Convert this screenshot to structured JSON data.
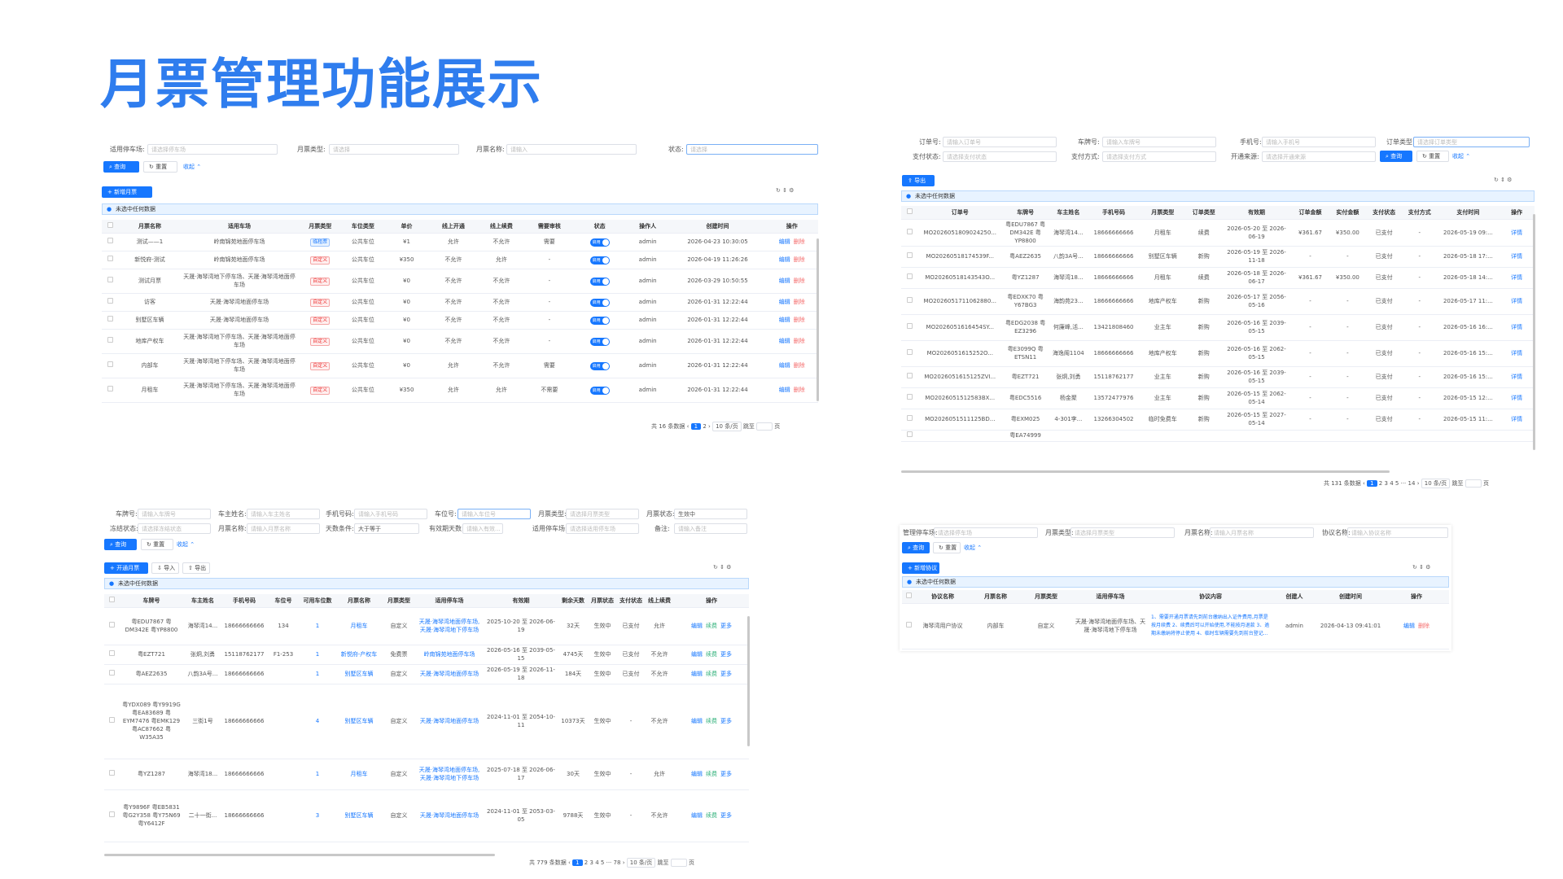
{
  "page_title": "月票管理功能展示",
  "p1": {
    "lbl_park": "适用停车场:",
    "ph_park": "请选择停车场",
    "lbl_type": "月票类型:",
    "ph_type": "请选择",
    "lbl_name": "月票名称:",
    "ph_name": "请输入",
    "lbl_status": "状态:",
    "ph_status": "请选择",
    "query": "查询",
    "reset": "重置",
    "collapse": "收起",
    "add": "新增月票",
    "info": "未选中任何数据",
    "headers": [
      "月票名称",
      "适用车场",
      "月票类型",
      "车位类型",
      "单价",
      "线上开通",
      "线上续费",
      "需要审核",
      "状态",
      "操作人",
      "创建时间",
      "操作"
    ],
    "rows": [
      [
        "测试——1",
        "岭南锦苑地面停车场",
        "临租票",
        "公共车位",
        "¥1",
        "允许",
        "不允许",
        "需要",
        "admin",
        "2026-04-23 10:30:05"
      ],
      [
        "新悦府-测试",
        "岭南锦苑地面停车场",
        "自定义",
        "公共车位",
        "¥350",
        "不允许",
        "允许",
        "-",
        "admin",
        "2026-04-19 11:26:26"
      ],
      [
        "测试月票",
        "天晟·海琴湾地下停车场、天晟·海琴湾地面停车场",
        "自定义",
        "公共车位",
        "¥0",
        "不允许",
        "不允许",
        "-",
        "admin",
        "2026-03-29 10:50:55"
      ],
      [
        "访客",
        "天晟·海琴湾地面停车场",
        "自定义",
        "公共车位",
        "¥0",
        "不允许",
        "不允许",
        "-",
        "admin",
        "2026-01-31 12:22:44"
      ],
      [
        "别墅区车辆",
        "天晟·海琴湾地面停车场",
        "自定义",
        "公共车位",
        "¥0",
        "不允许",
        "不允许",
        "-",
        "admin",
        "2026-01-31 12:22:44"
      ],
      [
        "地库产权车",
        "天晟·海琴湾地下停车场、天晟·海琴湾地面停车场",
        "自定义",
        "公共车位",
        "¥0",
        "不允许",
        "不允许",
        "-",
        "admin",
        "2026-01-31 12:22:44"
      ],
      [
        "内部车",
        "天晟·海琴湾地下停车场、天晟·海琴湾地面停车场",
        "自定义",
        "公共车位",
        "¥0",
        "允许",
        "不允许",
        "需要",
        "admin",
        "2026-01-31 12:22:44"
      ],
      [
        "月租车",
        "天晟·海琴湾地下停车场、天晟·海琴湾地面停车场",
        "自定义",
        "公共车位",
        "¥350",
        "允许",
        "允许",
        "不需要",
        "admin",
        "2026-01-31 12:22:44"
      ]
    ],
    "status_on": "启用",
    "op_edit": "编辑",
    "op_del": "删除",
    "total": "共 16 条数据",
    "pages": [
      "1",
      "2"
    ],
    "per_page": "10 条/页",
    "jump": "跳至",
    "page_unit": "页"
  },
  "p2": {
    "lbl_order": "订单号:",
    "ph_order": "请输入订单号",
    "lbl_plate": "车牌号:",
    "ph_plate": "请输入车牌号",
    "lbl_phone": "手机号:",
    "ph_phone": "请输入手机号",
    "lbl_otype": "订单类型:",
    "ph_otype": "请选择订单类型",
    "lbl_pay": "支付状态:",
    "ph_pay": "请选择支付状态",
    "lbl_paym": "支付方式:",
    "ph_paym": "请选择支付方式",
    "lbl_src": "开通来源:",
    "ph_src": "请选择开通来源",
    "query": "查询",
    "reset": "重置",
    "collapse": "收起",
    "export": "导出",
    "info": "未选中任何数据",
    "headers": [
      "订单号",
      "车牌号",
      "车主姓名",
      "手机号码",
      "月票类型",
      "订单类型",
      "有效期",
      "订单金额",
      "实付金额",
      "支付状态",
      "支付方式",
      "支付时间",
      "操作"
    ],
    "rows": [
      [
        "MO2026051809024250...",
        "粤EDU7867 粤DM342E 粤YP8800",
        "海琴湾14...",
        "18666666666",
        "月租车",
        "续费",
        "2026-05-20 至 2026-06-19",
        "¥361.67",
        "¥350.00",
        "已支付",
        "-",
        "2026-05-19 09:..."
      ],
      [
        "MO20260518174539F...",
        "粤AEZ2635",
        "八韵3A号...",
        "18666666666",
        "别墅区车辆",
        "新购",
        "2026-05-19 至 2026-11-18",
        "-",
        "-",
        "已支付",
        "-",
        "2026-05-18 17:..."
      ],
      [
        "MO20260518143543O...",
        "粤YZ1287",
        "海琴湾18...",
        "18666666666",
        "月租车",
        "续费",
        "2026-05-18 至 2026-06-17",
        "¥361.67",
        "¥350.00",
        "已支付",
        "-",
        "2026-05-18 14:..."
      ],
      [
        "MO2026051711062880...",
        "粤EDXK70 粤Y67BG3",
        "海韵苑23...",
        "18666666666",
        "地库产权车",
        "新购",
        "2026-05-17 至 2056-05-16",
        "-",
        "-",
        "已支付",
        "-",
        "2026-05-17 11:..."
      ],
      [
        "MO2026051616454SY...",
        "粤EDG2038 粤EZ3296",
        "何廉峰,活...",
        "13421808460",
        "业主车",
        "新购",
        "2026-05-16 至 2039-05-15",
        "-",
        "-",
        "已支付",
        "-",
        "2026-05-16 16:..."
      ],
      [
        "MO2026051615252O...",
        "粤E3099Q 粤ETSN11",
        "海逸阁1104",
        "18666666666",
        "地库产权车",
        "新购",
        "2026-05-16 至 2062-05-15",
        "-",
        "-",
        "已支付",
        "-",
        "2026-05-16 15:..."
      ],
      [
        "MO2026051615125ZVI...",
        "粤EZT721",
        "张炯,刘勇",
        "15118762177",
        "业主车",
        "新购",
        "2026-05-16 至 2039-05-15",
        "-",
        "-",
        "已支付",
        "-",
        "2026-05-16 15:..."
      ],
      [
        "MO2026051512583BX...",
        "粤EDC5516",
        "杨金聚",
        "13572477976",
        "业主车",
        "新购",
        "2026-05-15 至 2062-05-14",
        "-",
        "-",
        "已支付",
        "-",
        "2026-05-15 12:..."
      ],
      [
        "MO2026051511125BD...",
        "粤EXM025",
        "4-301李...",
        "13266304502",
        "临时免费车",
        "新购",
        "2026-05-15 至 2027-05-14",
        "-",
        "-",
        "已支付",
        "-",
        "2026-05-15 11:..."
      ],
      [
        "",
        "粤EA74999",
        "",
        "",
        "",
        "",
        "",
        "",
        "",
        "",
        "",
        ""
      ]
    ],
    "op_detail": "详情",
    "total": "共 131 条数据",
    "pages": [
      "1",
      "2",
      "3",
      "4",
      "5",
      "···",
      "14"
    ],
    "per_page": "10 条/页",
    "jump": "跳至",
    "page_unit": "页"
  },
  "p3": {
    "lbl_plate": "车牌号:",
    "ph_plate": "请输入车牌号",
    "lbl_owner": "车主姓名:",
    "ph_owner": "请输入车主姓名",
    "lbl_phone": "手机号码:",
    "ph_phone": "请输入手机号码",
    "lbl_space": "车位号:",
    "ph_space": "请输入车位号",
    "lbl_mtype": "月票类型:",
    "ph_mtype": "请选择月票类型",
    "lbl_mstat": "月票状态:",
    "val_mstat": "生效中",
    "lbl_freeze": "冻结状态:",
    "ph_freeze": "请选择冻结状态",
    "lbl_mname": "月票名称:",
    "ph_mname": "请输入月票名称",
    "lbl_days": "天数条件:",
    "val_days": "大于等于",
    "lbl_valid": "有效期天数:",
    "ph_valid": "请输入有效...",
    "lbl_park": "适用停车场:",
    "ph_park": "请选择适用停车场",
    "lbl_note": "备注:",
    "ph_note": "请输入备注",
    "query": "查询",
    "reset": "重置",
    "collapse": "收起",
    "open": "开通月票",
    "import": "导入",
    "export": "导出",
    "info": "未选中任何数据",
    "headers": [
      "车牌号",
      "车主姓名",
      "手机号码",
      "车位号",
      "可用车位数",
      "月票名称",
      "月票类型",
      "适用停车场",
      "有效期",
      "剩余天数",
      "月票状态",
      "支付状态",
      "线上续费",
      "操作"
    ],
    "rows": [
      [
        "粤EDU7867 粤DM342E 粤YP8800",
        "海琴湾14...",
        "18666666666",
        "134",
        "1",
        "月租车",
        "自定义",
        "天晟·海琴湾地面停车场,天晟·海琴湾地下停车场",
        "2025-10-20 至 2026-06-19",
        "32天",
        "生效中",
        "已支付",
        "允许"
      ],
      [
        "粤EZT721",
        "张炯,刘勇",
        "15118762177",
        "F1-253",
        "1",
        "新悦府-产权车",
        "免费票",
        "岭南锦苑地面停车场",
        "2026-05-16 至 2039-05-15",
        "4745天",
        "生效中",
        "已支付",
        "不允许"
      ],
      [
        "粤AEZ2635",
        "八韵3A号...",
        "18666666666",
        "",
        "1",
        "别墅区车辆",
        "自定义",
        "天晟·海琴湾地面停车场",
        "2026-05-19 至 2026-11-18",
        "184天",
        "生效中",
        "已支付",
        "不允许"
      ],
      [
        "粤YDX089 粤Y9919G 粤EA83689 粤EYM7476 粤EMK129 粤AC87662 粤W35A35",
        "三街1号",
        "18666666666",
        "",
        "4",
        "别墅区车辆",
        "自定义",
        "天晟·海琴湾地面停车场",
        "2024-11-01 至 2054-10-11",
        "10373天",
        "生效中",
        "-",
        "不允许"
      ],
      [
        "粤YZ1287",
        "海琴湾18...",
        "18666666666",
        "",
        "1",
        "月租车",
        "自定义",
        "天晟·海琴湾地面停车场,天晟·海琴湾地下停车场",
        "2025-07-18 至 2026-06-17",
        "30天",
        "生效中",
        "-",
        "允许"
      ],
      [
        "粤Y9896F 粤EB5831 粤G2Y358 粤Y75N69 粤Y6412F",
        "二十一街...",
        "18666666666",
        "",
        "3",
        "别墅区车辆",
        "自定义",
        "天晟·海琴湾地面停车场",
        "2024-11-01 至 2053-03-05",
        "9788天",
        "生效中",
        "-",
        "不允许"
      ]
    ],
    "op_edit": "编辑",
    "op_renew": "续费",
    "op_more": "更多",
    "total": "共 779 条数据",
    "pages": [
      "1",
      "2",
      "3",
      "4",
      "5",
      "···",
      "78"
    ],
    "per_page": "10 条/页",
    "jump": "跳至",
    "page_unit": "页"
  },
  "p4": {
    "lbl_park": "管理停车场:",
    "ph_park": "请选择停车场",
    "lbl_mtype": "月票类型:",
    "ph_mtype": "请选择月票类型",
    "lbl_mname": "月票名称:",
    "ph_mname": "请输入月票名称",
    "lbl_agree": "协议名称:",
    "ph_agree": "请输入协议名称",
    "query": "查询",
    "reset": "重置",
    "collapse": "收起",
    "add": "新增协议",
    "info": "未选中任何数据",
    "headers": [
      "协议名称",
      "月票名称",
      "月票类型",
      "适用停车场",
      "协议内容",
      "创建人",
      "创建时间",
      "操作"
    ],
    "rows": [
      [
        "海琴湾用户协议",
        "内部车",
        "自定义",
        "天晟·海琴湾地面停车场、天晟·海琴湾地下停车场",
        "1、需要开通月票请先到前台缴纳出入证件费用,月票是按月续费 2、续费后可以开始使用,不能按月退款 3、逾期未缴纳将停止使用 4、临时车辆需要先到前台登记...",
        "admin",
        "2026-04-13 09:41:01"
      ]
    ],
    "op_edit": "编辑",
    "op_del": "删除"
  }
}
